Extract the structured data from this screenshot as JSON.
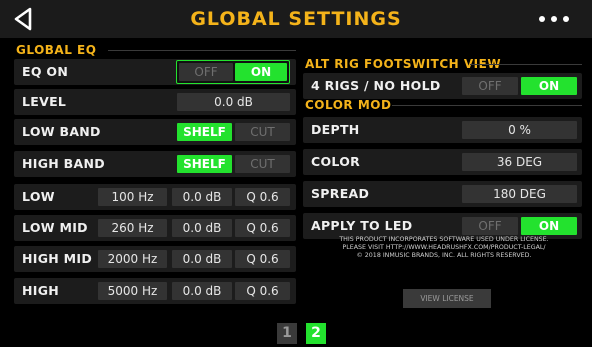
{
  "header": {
    "title": "GLOBAL SETTINGS",
    "back_icon": "back-arrow-icon",
    "more_icon": "more-dots-icon"
  },
  "global_eq": {
    "section_title": "GLOBAL EQ",
    "eq_on": {
      "label": "EQ ON",
      "off": "OFF",
      "on": "ON",
      "state": "on"
    },
    "level": {
      "label": "LEVEL",
      "value": "0.0 dB"
    },
    "low_band": {
      "label": "LOW BAND",
      "shelf": "SHELF",
      "cut": "CUT",
      "selected": "shelf"
    },
    "high_band": {
      "label": "HIGH BAND",
      "shelf": "SHELF",
      "cut": "CUT",
      "selected": "shelf"
    },
    "bands": [
      {
        "label": "LOW",
        "freq": "100 Hz",
        "gain": "0.0 dB",
        "q": "Q 0.6"
      },
      {
        "label": "LOW MID",
        "freq": "260 Hz",
        "gain": "0.0 dB",
        "q": "Q 0.6"
      },
      {
        "label": "HIGH MID",
        "freq": "2000 Hz",
        "gain": "0.0 dB",
        "q": "Q 0.6"
      },
      {
        "label": "HIGH",
        "freq": "5000 Hz",
        "gain": "0.0 dB",
        "q": "Q 0.6"
      }
    ]
  },
  "alt_rig": {
    "section_title": "ALT RIG FOOTSWITCH VIEW",
    "label": "4 RIGS / NO HOLD",
    "off": "OFF",
    "on": "ON",
    "state": "on"
  },
  "color_mod": {
    "section_title": "COLOR MOD",
    "depth": {
      "label": "DEPTH",
      "value": "0 %"
    },
    "color": {
      "label": "COLOR",
      "value": "36 DEG"
    },
    "spread": {
      "label": "SPREAD",
      "value": "180 DEG"
    },
    "apply_to_led": {
      "label": "APPLY TO LED",
      "off": "OFF",
      "on": "ON",
      "state": "on"
    }
  },
  "license": {
    "line1": "THIS PRODUCT INCORPORATES SOFTWARE USED UNDER LICENSE.",
    "line2": "PLEASE VISIT HTTP://WWW.HEADRUSHFX.COM/PRODUCT-LEGAL/",
    "line3": "© 2018 INMUSIC BRANDS, INC. ALL RIGHTS RESERVED.",
    "button": "VIEW LICENSE"
  },
  "pagination": {
    "pages": [
      "1",
      "2"
    ],
    "current": "2"
  },
  "colors": {
    "accent": "#f4b31a",
    "active": "#23e22e",
    "row_bg": "#1c1c1c",
    "cell_bg": "#333333"
  }
}
